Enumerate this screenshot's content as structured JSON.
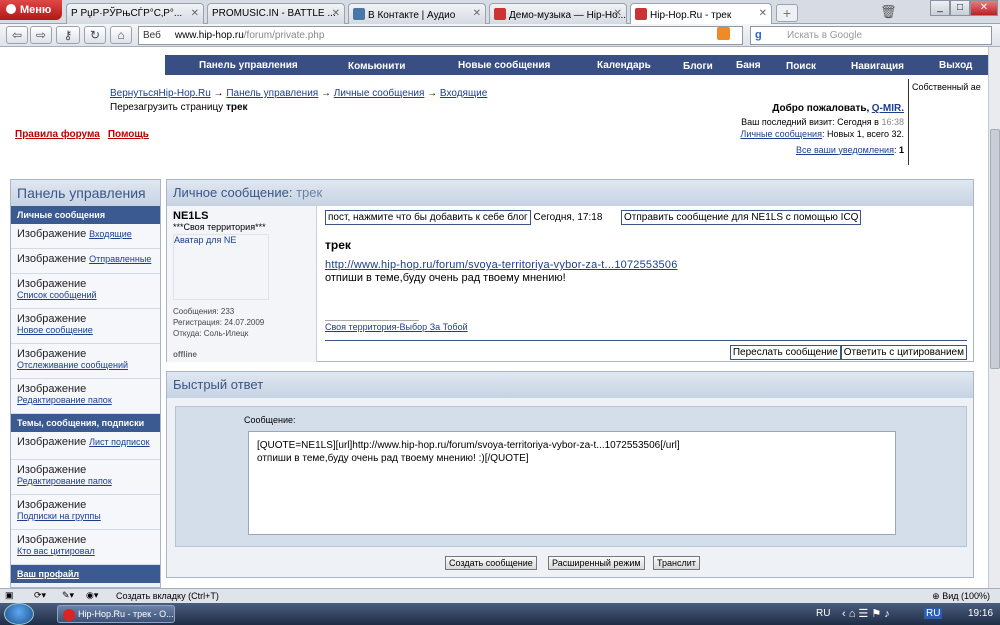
{
  "browser": {
    "menu_label": "Меню",
    "tabs": [
      {
        "label": "Р РџР·РЎРњСЃР°С‚Р°..."
      },
      {
        "label": "PROMUSIC.IN - BATTLE ..."
      },
      {
        "label": "В Контакте | Аудио"
      },
      {
        "label": "Демо-музыка — Hip-Ho..."
      },
      {
        "label": "Hip-Hop.Ru - трек"
      }
    ],
    "address": {
      "prefix": "Веб",
      "domain": "www.hip-hop.ru",
      "path": "/forum/private.php"
    },
    "search_placeholder": "Искать в Google"
  },
  "forum": {
    "nav": [
      "Панель управления",
      "Комьюнити",
      "Новые сообщения",
      "Календарь",
      "Блоги",
      "Баня",
      "Поиск",
      "Навигация",
      "Выход"
    ],
    "own_shade": "Собственный ае",
    "back_prefix": "Вернуться",
    "breadcrumb": [
      "Hip-Hop.Ru",
      "Панель управления",
      "Личные сообщения",
      "Входящие"
    ],
    "reload_prefix": "Перезагрузить страницу",
    "reload_title": "трек",
    "rules": "Правила форума",
    "help": "Помощь",
    "welcome": {
      "greeting": "Добро пожаловать,",
      "user": "Q-MIR.",
      "last_visit": "Ваш последний визит: Сегодня в",
      "last_time": "16:38",
      "pm_link": "Личные сообщения",
      "pm_counts": ": Новых 1, всего 32.",
      "notif_link": "Все ваши уведомления",
      "notif_count": "1"
    }
  },
  "sidebar": {
    "title": "Панель управления",
    "section1": "Личные сообщения",
    "items1": [
      {
        "img": "Изображение",
        "link": "Входящие"
      },
      {
        "img": "Изображение",
        "link": "Отправленные"
      },
      {
        "img": "Изображение",
        "link": "Список сообщений"
      },
      {
        "img": "Изображение",
        "link": "Новое сообщение"
      },
      {
        "img": "Изображение",
        "link": "Отслеживание сообщений"
      },
      {
        "img": "Изображение",
        "link": "Редактирование папок"
      }
    ],
    "section2": "Темы, сообщения, подписки",
    "items2": [
      {
        "img": "Изображение",
        "link": "Лист подписок"
      },
      {
        "img": "Изображение",
        "link": "Редактирование папок"
      },
      {
        "img": "Изображение",
        "link": "Подписки на группы"
      },
      {
        "img": "Изображение",
        "link": "Кто вас цитировал"
      }
    ],
    "section3": "Ваш профайл"
  },
  "message": {
    "panel_title": "Личное сообщение:",
    "panel_subject": "трек",
    "author": "NE1LS",
    "territory": "***Своя территория***",
    "avatar_alt": "Аватар для NE",
    "posts": "Сообщения: 233",
    "reg": "Регистрация: 24.07.2009",
    "from": "Откуда: Соль-Илецк",
    "status": "offline",
    "hint": "пост, нажмите что бы добавить к себе блог",
    "date": "Сегодня, 17:18",
    "icq": "Отправить сообщение для NE1LS с помощью ICQ",
    "subject": "трек",
    "link": "http://www.hip-hop.ru/forum/svoya-territoriya-vybor-za-t...1072553506",
    "text": "отпиши в теме,буду очень рад твоему мнению!",
    "signature": "Своя территория-Выбор За Тобой",
    "forward": "Переслать сообщение",
    "quote": "Ответить с цитированием"
  },
  "quick_reply": {
    "title": "Быстрый ответ",
    "label": "Сообщение:",
    "line1": "[QUOTE=NE1LS][url]http://www.hip-hop.ru/forum/svoya-territoriya-vybor-za-t...1072553506[/url]",
    "line2": "отпиши в теме,буду очень рад твоему мнению! :)[/QUOTE]",
    "btn_create": "Создать сообщение",
    "btn_advanced": "Расширенный режим",
    "btn_translit": "Транслит"
  },
  "status": {
    "new_tab": "Создать вкладку (Ctrl+T)",
    "zoom": "Вид (100%)"
  },
  "taskbar": {
    "item": "Hip-Hop.Ru - трек - О...",
    "lang1": "RU",
    "lang2": "RU",
    "time": "19:16"
  }
}
